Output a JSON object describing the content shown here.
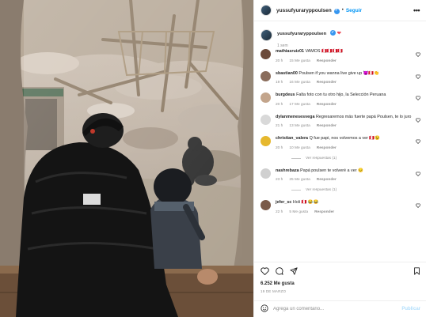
{
  "post": {
    "username": "yussufyuraryppoulsen",
    "follow_label": "Seguir",
    "separator": "•",
    "more_label": "•••",
    "caption": {
      "username": "yussufyuraryppoulsen",
      "heart": "❤",
      "time": "1 sem"
    },
    "likes": "6.252 Me gusta",
    "date": "19 DE MARZO",
    "add_comment_placeholder": "Agrega un comentario...",
    "publish_label": "Publicar"
  },
  "comments": [
    {
      "username": "mathiasruiz01",
      "text": "VAMOS 🇵🇪🇵🇪🇵🇪🇵🇪",
      "time": "20 h",
      "likes": "15 Me gusta",
      "reply": "Responder",
      "avatar_color": "#6b4a3a",
      "view_replies": ""
    },
    {
      "username": "sbastian00",
      "text": "Poulsen if you wanna live give up 😈🇵🇪👏",
      "time": "19 h",
      "likes": "16 Me gusta",
      "reply": "Responder",
      "avatar_color": "#8a6d5c",
      "view_replies": ""
    },
    {
      "username": "burgdeus",
      "text": "Falta foto con tu otro hijo, la Selección Peruana",
      "time": "20 h",
      "likes": "17 Me gusta",
      "reply": "Responder",
      "avatar_color": "#c3a58c",
      "view_replies": ""
    },
    {
      "username": "dylanmenesesvega",
      "text": "Regresaremos más fuerte papá Poulsen, te lo juro",
      "time": "21 h",
      "likes": "13 Me gusta",
      "reply": "Responder",
      "avatar_color": "#d9d9d9",
      "view_replies": ""
    },
    {
      "username": "christian_valera",
      "text": "Q fue papi, nos volvemos a ver 🇵🇪😉",
      "time": "20 h",
      "likes": "10 Me gusta",
      "reply": "Responder",
      "avatar_color": "#e6b82e",
      "view_replies": "Ver respuestas (1)"
    },
    {
      "username": "nashrebaza",
      "text": "Papá poulsen te volveré a ver 😔",
      "time": "23 h",
      "likes": "25 Me gusta",
      "reply": "Responder",
      "avatar_color": "#d0d0d0",
      "view_replies": "Ver respuestas (1)"
    },
    {
      "username": "jefer_sc",
      "text": "Holi 🇵🇪 😂😂",
      "time": "22 h",
      "likes": "5 Me gusta",
      "reply": "Responder",
      "avatar_color": "#7a5a48",
      "view_replies": ""
    }
  ]
}
